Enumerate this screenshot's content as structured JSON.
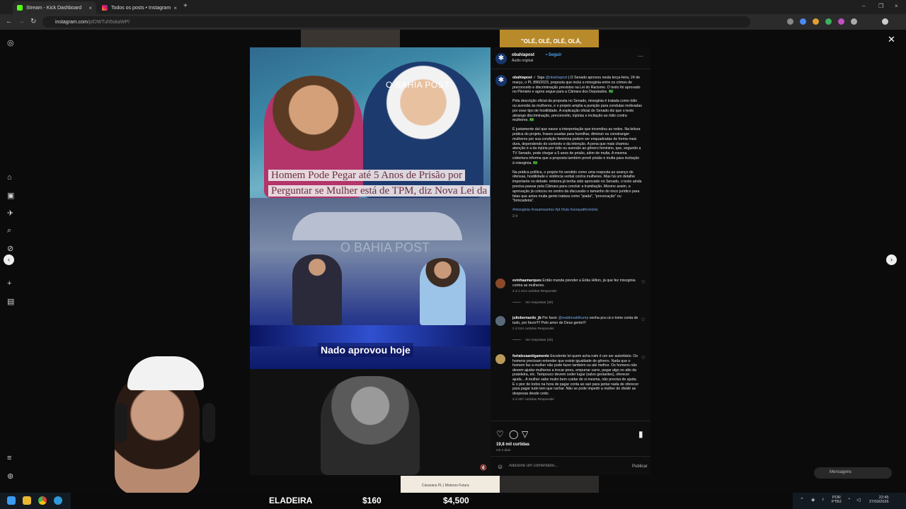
{
  "browser": {
    "tabs": [
      {
        "label": "Stream - Kick Dashboard",
        "close": "×"
      },
      {
        "label": "Todos os posts • Instagram",
        "close": "×"
      }
    ],
    "new_tab": "+",
    "window_controls": {
      "minimize": "–",
      "restore": "❐",
      "close": "×"
    },
    "nav": {
      "back": "←",
      "forward": "→",
      "reload": "↻"
    },
    "url_host": "instagram.com",
    "url_path": "/p/DWTuh5skaWP/"
  },
  "background": {
    "top_right_text": "\"OLÉ, OLÉ, OLÉ, OLÁ,",
    "bottom_text": "Caravans PL | Motores Futura"
  },
  "post": {
    "media": {
      "image_logo": "O BAHIA POST",
      "headline": "Homem Pode Pegar até 5 Anos de Prisão por Perguntar se Mulher está de TPM, diz Nova Lei da Misoginia",
      "video_logo": "O BAHIA POST",
      "video_caption": "Nado aprovou hoje",
      "volume_icon": "🔇"
    },
    "header": {
      "avatar": "✱",
      "username": "obahiapost",
      "follow": "• Seguir",
      "audio": "Áudio original",
      "more": "···"
    },
    "caption": {
      "username": "obahiapost",
      "prefix": " ✓ Siga ",
      "mention": "@obahiapost",
      "p1": " | O Senado aprovou nesta terça-feira, 24 de março, o PL 896/2023, proposta que inclui a misoginia entre os crimes de preconceito e discriminação previstos na Lei do Racismo. O texto foi aprovado no Plenário e agora segue para a Câmara dos Deputados. 🇧🇷",
      "p2": "Pela descrição oficial da proposta no Senado, misoginia é tratada como ódio ou aversão às mulheres, e o projeto amplia a punição para condutas motivadas por esse tipo de hostilidade. A explicação oficial do Senado diz que o texto abrange discriminação, preconceito, injúrias e incitação ao ódio contra mulheres. 🇧🇷",
      "p3": "É justamente daí que nasce a interpretação que incendiou as redes. Na leitura prática do projeto, frases usadas para humilhar, diminuir ou constranger mulheres por sua condição feminina podem ser enquadradas de forma mais dura, dependendo do contexto e da intenção. A pena que mais chamou atenção é a da injúria por ódio ou aversão ao gênero feminino, que, segundo a TV Senado, pode chegar a 5 anos de prisão, além de multa. A mesma cobertura informa que a proposta também prevê prisão e multa para incitação à misoginia. 🇧🇷",
      "p4": "Na prática política, o projeto foi vendido como uma resposta ao avanço de ofensas, hostilidade e violência verbal contra mulheres. Mas há um detalhe importante no debate: embora já tenha sido aprovado no Senado, o texto ainda precisa passar pela Câmara para concluir a tramitação. Mesmo assim, a aprovação já colocou no centro da discussão o tamanho do risco jurídico para falas que antes muita gente tratava como \"piada\", \"provocação\" ou \"brincadeira\".",
      "tags": "#misoginia #rasamsantos #pt #lula #sorayathronicke",
      "time": "2 d"
    },
    "comments": [
      {
        "username": "evinhaamarques",
        "text": " Então manda prender a Erika Hilton, já que fez misoginia contra as mulheres.",
        "meta": "2 d     1.444 curtidas     Responder",
        "replies": "Ver respostas (30)",
        "color": "#8a4a2a"
      },
      {
        "username": "juliobernardo_jb",
        "text_pre": " Por favor ",
        "mention": "@realdonaldtrump",
        "text": " venha pra cá e tome conta de tudo, por favor!!!! Pelo amor de Deus gente!!!",
        "meta": "2 d     244 curtidas     Responder",
        "replies": "Ver respostas (20)",
        "color": "#5a6a7a"
      },
      {
        "username": "fortalezaantigamente",
        "text": " Excelente lei quem acha ruim é um ser autoritário. Os homens precisam entender que existe igualdade de gênero. Nada que o homem faz a mulher não pode fazer também ou até melhor. Os homens não devem ajudar mulheres a trocar pneu, empurrar carro, pegar algo no alto da prateleira, etc. Tampouco devem ceder lugar (salvo gestantes), oferecer ajuda... A mulher sabe muito bem cuidar de si mesma, não precisa de ajuda. E o pior de todos na hora de pagar conta ao sair para jantar nada de oferecer para pagar tudo tem que rachar. Não se pode impedir a mulher de dividir as despesas desde cedo.",
        "meta": "2 d     257 curtidas     Responder",
        "color": "#b99a5a"
      }
    ],
    "actions": {
      "like": "♡",
      "comment": "◯",
      "share": "▽",
      "save": "▮"
    },
    "likes": "19,8 mil curtidas",
    "ago": "Há 2 dias",
    "comment_placeholder": "Adicione um comentário...",
    "publish": "Publicar",
    "emoji": "☺"
  },
  "viewer": {
    "close": "✕",
    "prev": "‹",
    "next": "›"
  },
  "overlay": {
    "messages": "Mensagens"
  },
  "ticker": {
    "item1": "ELADEIRA",
    "item2": "$160",
    "item3": "$4,500"
  },
  "taskbar": {
    "lang_top": "POR",
    "lang_bottom": "PTB2",
    "time": "22:45",
    "date": "27/03/2026"
  }
}
